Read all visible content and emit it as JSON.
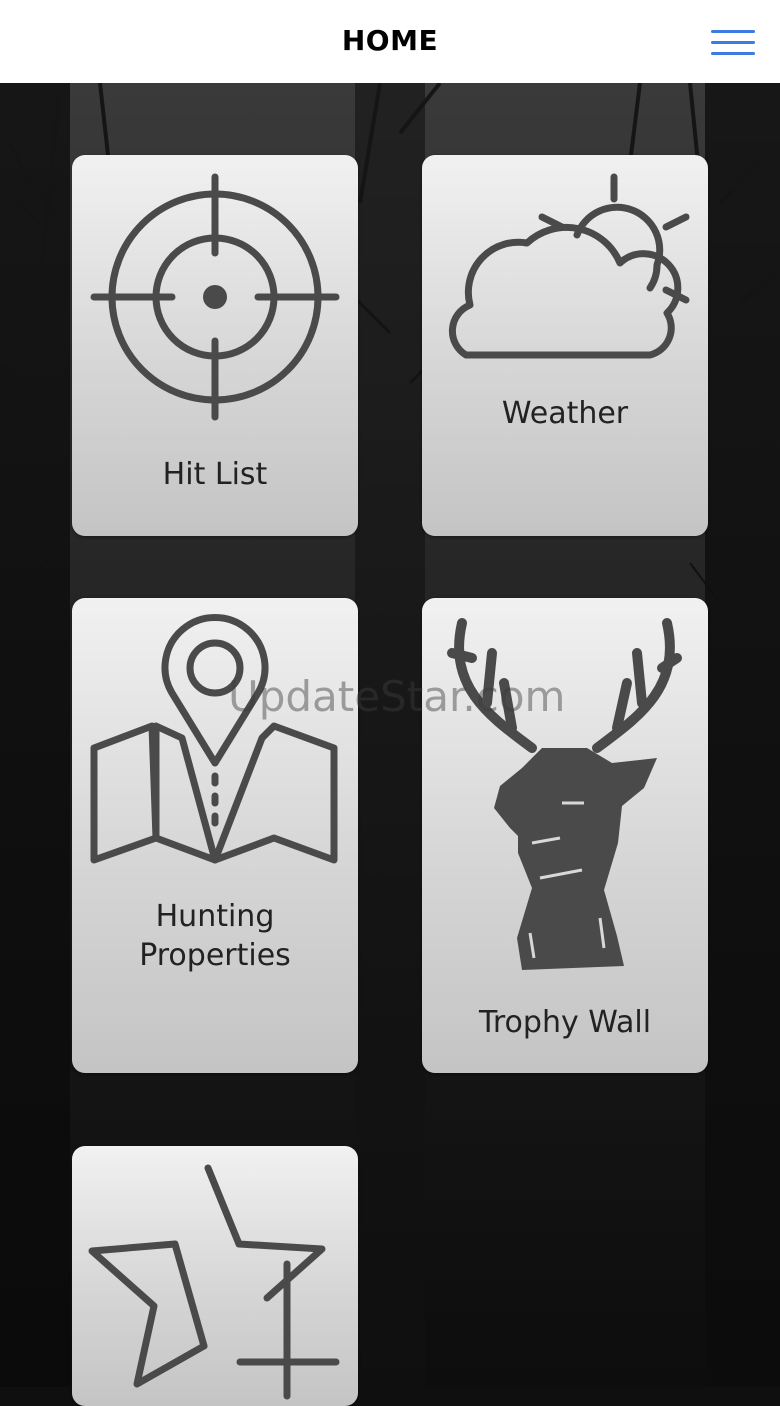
{
  "header": {
    "title": "HOME",
    "menu_icon": "hamburger-icon",
    "menu_color": "#3c7be0"
  },
  "tiles": [
    {
      "label": "Hit List",
      "icon": "crosshair-icon"
    },
    {
      "label": "Weather",
      "icon": "cloud-sun-icon"
    },
    {
      "label_line1": "Hunting",
      "label_line2": "Properties",
      "icon": "map-pin-icon"
    },
    {
      "label": "Trophy Wall",
      "icon": "deer-head-icon"
    },
    {
      "icon": "star-add-icon"
    }
  ],
  "watermark": "UpdateStar.com",
  "colors": {
    "tile_icon": "#4a4a4a",
    "background": "#0f0f0f"
  }
}
